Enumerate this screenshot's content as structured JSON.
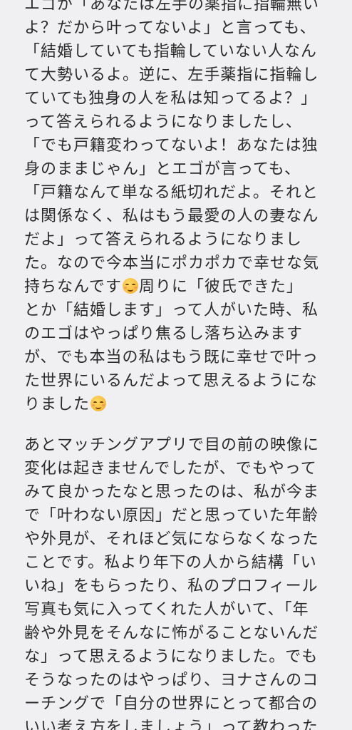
{
  "paragraphs": [
    {
      "lines": [
        "エゴが「あなたは左手の薬指に指輪無い",
        "よ？だから叶ってないよ」と言っても、",
        "「結婚していても指輪していない人なん",
        "て大勢いるよ。逆に、左手薬指に指輪し",
        "ていても独身の人を私は知ってるよ？」",
        "って答えられるようになりましたし、",
        "「でも戸籍変わってないよ！あなたは独",
        "身のままじゃん」とエゴが言っても、",
        "「戸籍なんて単なる紙切れだよ。それと",
        "は関係なく、私はもう最愛の人の妻なん",
        "だよ」って答えられるようになりまし",
        "た。なので今本当にポカポカで幸せな気",
        {
          "before": "持ちなんです",
          "emoji": "smiling-face-icon",
          "after": "周りに「彼氏できた」"
        },
        "とか「結婚します」って人がいた時、私",
        "のエゴはやっぱり焦るし落ち込みます",
        "が、でも本当の私はもう既に幸せで叶っ",
        "た世界にいるんだよって思えるようにな",
        {
          "before": "りました",
          "emoji": "smiling-face-icon",
          "after": ""
        }
      ]
    },
    {
      "lines": [
        "あとマッチングアプリで目の前の映像に",
        "変化は起きませんでしたが、でもやって",
        "みて良かったなと思ったのは、私が今ま",
        "で「叶わない原因」だと思っていた年齢",
        "や外見が、それほど気にならなくなった",
        "ことです。私より年下の人から結構「い",
        "いね」をもらったり、私のプロフィール",
        "写真も気に入ってくれた人がいて、「年",
        "齢や外見をそんなに怖がることないんだ",
        "な」って思えるようになりました。でも",
        "そうなったのはやっぱり、ヨナさんのコ",
        "ーチングで「自分の世界にとって都合の",
        "いい考え方をしましょう」って教わった"
      ]
    }
  ]
}
